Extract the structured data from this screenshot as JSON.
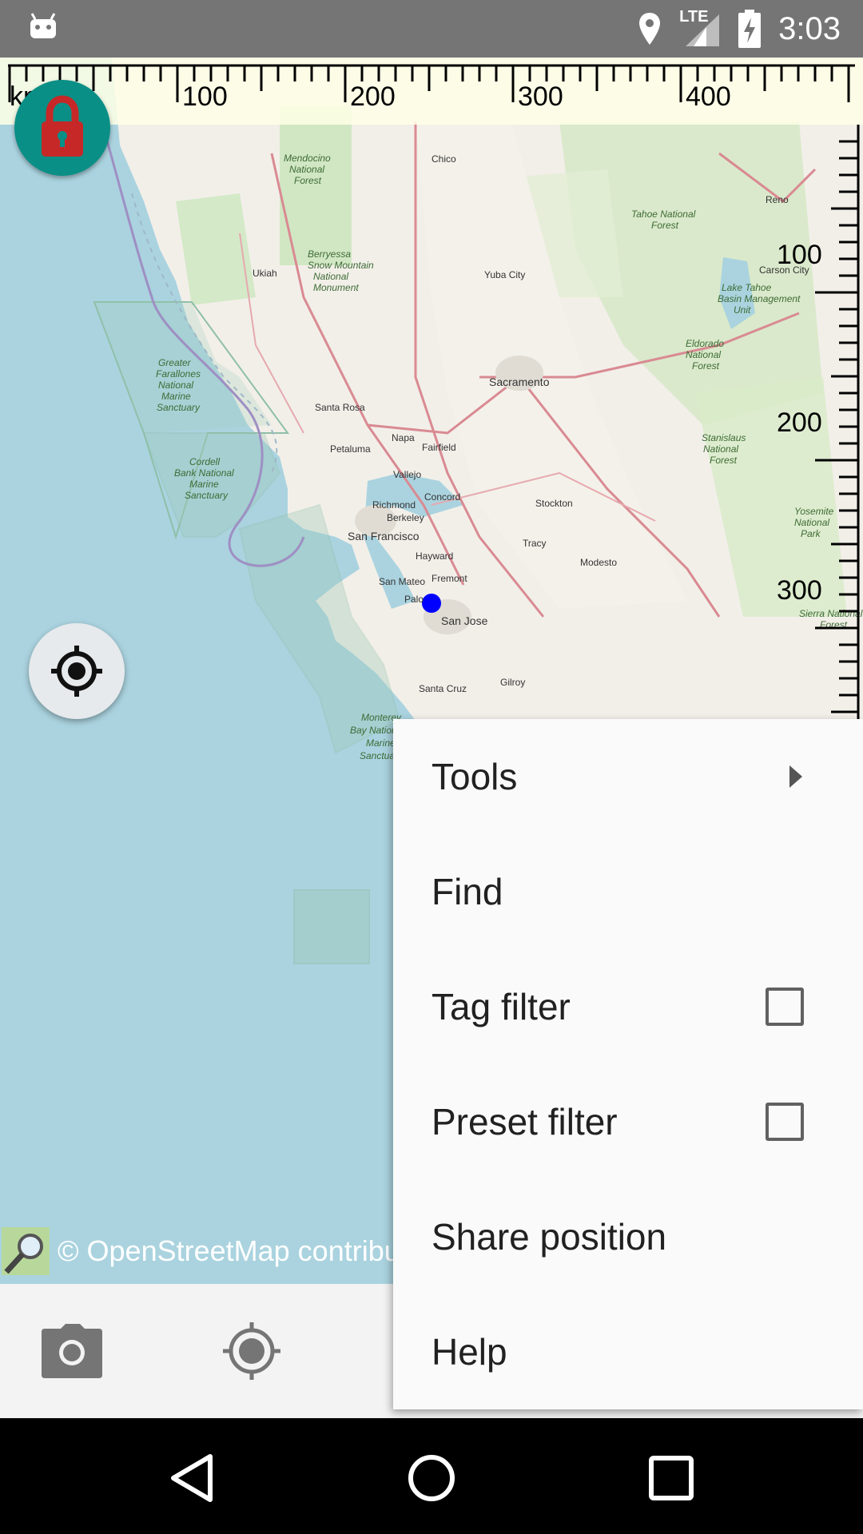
{
  "status_bar": {
    "time": "3:03",
    "network": "LTE"
  },
  "map": {
    "attribution": "© OpenStreetMap contributors",
    "ruler_top": {
      "unit": "km",
      "labels": [
        "100",
        "200",
        "300",
        "400"
      ]
    },
    "ruler_right": {
      "labels": [
        "100",
        "200",
        "300"
      ]
    },
    "place_labels": [
      "Mendocino National Forest",
      "Chico",
      "Tahoe National Forest",
      "Ukiah",
      "Berryessa Snow Mountain National Monument",
      "Yuba City",
      "Carson City",
      "Lake Tahoe Basin Management Unit",
      "Reno",
      "Greater Farallones National Marine Sanctuary",
      "Sacramento",
      "Eldorado National Forest",
      "Santa Rosa",
      "Napa",
      "Fairfield",
      "Petaluma",
      "Vallejo",
      "Cordell Bank National Marine Sanctuary",
      "Richmond",
      "Concord",
      "Berkeley",
      "Stockton",
      "Stanislaus National Forest",
      "San Francisco",
      "Hayward",
      "Tracy",
      "Modesto",
      "Yosemite National Park",
      "San Mateo",
      "Fremont",
      "Palo",
      "San Jose",
      "Sierra National Forest",
      "Gilroy",
      "Santa Cruz",
      "Monterey Bay National Marine Sanctuary"
    ]
  },
  "menu": {
    "items": [
      {
        "label": "Tools",
        "type": "submenu"
      },
      {
        "label": "Find",
        "type": "plain"
      },
      {
        "label": "Tag filter",
        "type": "checkbox",
        "checked": false
      },
      {
        "label": "Preset filter",
        "type": "checkbox",
        "checked": false
      },
      {
        "label": "Share position",
        "type": "plain"
      },
      {
        "label": "Help",
        "type": "plain"
      }
    ]
  },
  "icons": {
    "lock": "lock-icon",
    "gps": "gps-crosshair-icon",
    "camera": "camera-icon",
    "location": "location-target-icon"
  },
  "colors": {
    "lock_button": "#0a8f86",
    "lock_icon": "#c62828",
    "location_dot": "#0000ff"
  }
}
